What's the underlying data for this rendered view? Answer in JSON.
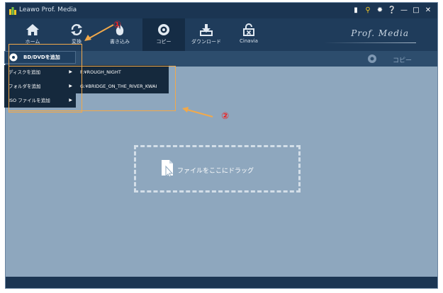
{
  "titlebar": {
    "title": "Leawo Prof. Media",
    "controls": [
      "chat-icon",
      "key-icon",
      "gear-icon",
      "help-icon",
      "minimize-icon",
      "maximize-icon",
      "close-icon"
    ]
  },
  "toolbar": {
    "items": [
      {
        "label": "ホーム",
        "icon": "home-icon"
      },
      {
        "label": "変換",
        "icon": "convert-icon"
      },
      {
        "label": "書き込み",
        "icon": "burn-icon"
      },
      {
        "label": "コピー",
        "icon": "copy-disc-icon",
        "active": true
      },
      {
        "label": "ダウンロード",
        "icon": "download-icon"
      },
      {
        "label": "Cinavia",
        "icon": "cinavia-unlock-icon"
      }
    ],
    "brand": "Prof. Media"
  },
  "tabbar": {
    "copy_label": "コピー"
  },
  "add_bd_button": {
    "label": "BD/DVDを追加"
  },
  "menu": {
    "items": [
      {
        "label": "ディスクを追加"
      },
      {
        "label": "フォルダを追加"
      },
      {
        "label": "ISO ファイルを追加"
      }
    ]
  },
  "submenu": {
    "items": [
      {
        "label": "F:¥ROUGH_NIGHT"
      },
      {
        "label": "G:¥BRIDGE_ON_THE_RIVER_KWAI"
      }
    ]
  },
  "dropzone": {
    "label": "ファイルをここにドラッグ"
  },
  "annotations": {
    "num1": "①",
    "num2": "②"
  },
  "colors": {
    "annotation_box": "#f2a94a",
    "annotation_number": "#ee2222",
    "content_bg": "#8ea7be",
    "chrome_bg": "#1d3a57"
  }
}
